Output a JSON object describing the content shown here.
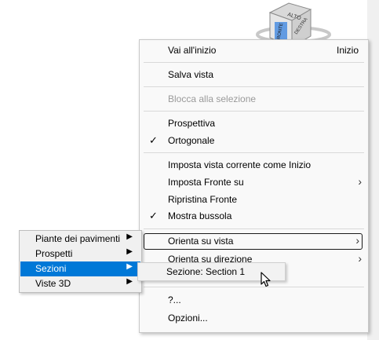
{
  "viewcube": {
    "top_label": "ALTO",
    "front_label": "FRONTE",
    "right_label": "DESTRA"
  },
  "menu": {
    "vai_inizio": {
      "label": "Vai all'inizio",
      "shortcut": "Inizio"
    },
    "salva_vista": "Salva vista",
    "blocca": "Blocca alla selezione",
    "prospettiva": "Prospettiva",
    "ortogonale": "Ortogonale",
    "imposta_vista_inizio": "Imposta vista corrente come Inizio",
    "imposta_fronte": "Imposta Fronte su",
    "ripristina_fronte": "Ripristina Fronte",
    "mostra_bussola": "Mostra bussola",
    "orienta_vista": "Orienta su vista",
    "orienta_direzione": "Orienta su direzione",
    "help": "?...",
    "opzioni": "Opzioni...",
    "checkmark": "✓"
  },
  "submenu_left": {
    "items": [
      "Piante dei pavimenti",
      "Prospetti",
      "Sezioni",
      "Viste 3D"
    ]
  },
  "submenu_sezioni": {
    "item": "Sezione: Section 1"
  }
}
